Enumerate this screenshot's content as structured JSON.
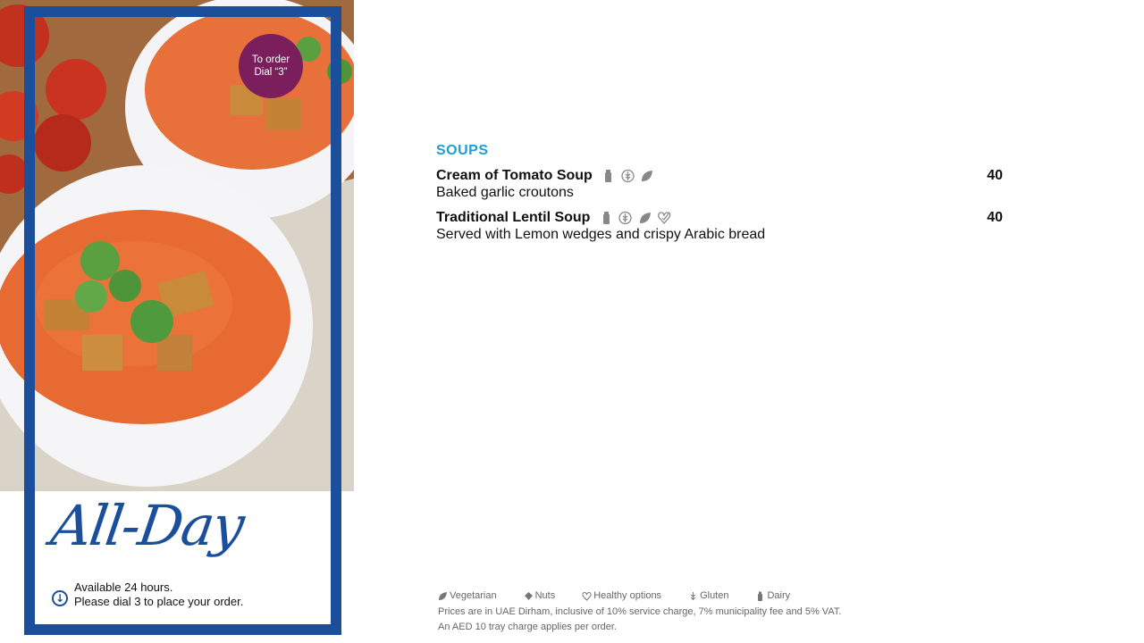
{
  "hero": {
    "order_badge": {
      "line1": "To order",
      "line2": "Dial “3”"
    },
    "title": "All-Day",
    "availability": {
      "line1": "Available 24 hours.",
      "line2": "Please dial 3 to place your order."
    }
  },
  "menu": {
    "section": "SOUPS",
    "items": [
      {
        "name": "Cream of Tomato Soup",
        "desc": "Baked garlic croutons",
        "price": "40",
        "icons": [
          "dairy-icon",
          "gluten-icon",
          "vegetarian-icon"
        ]
      },
      {
        "name": "Traditional Lentil Soup",
        "desc": "Served with Lemon wedges and crispy Arabic bread",
        "price": "40",
        "icons": [
          "dairy-icon",
          "gluten-icon",
          "vegetarian-icon",
          "healthy-icon"
        ]
      }
    ]
  },
  "legend": {
    "items": [
      {
        "icon": "vegetarian-icon",
        "label": "Vegetarian"
      },
      {
        "icon": "nuts-icon",
        "label": "Nuts"
      },
      {
        "icon": "healthy-icon",
        "label": "Healthy options"
      },
      {
        "icon": "gluten-icon",
        "label": "Gluten"
      },
      {
        "icon": "dairy-icon",
        "label": "Dairy"
      }
    ],
    "note1": "Prices are in UAE Dirham, inclusive of 10% service charge, 7% municipality fee and 5% VAT.",
    "note2": "An AED 10 tray charge applies per order."
  },
  "colors": {
    "frame": "#1b4f9c",
    "badge": "#7a1f5c",
    "section": "#1aa0d8",
    "soup": "#e8703a"
  }
}
